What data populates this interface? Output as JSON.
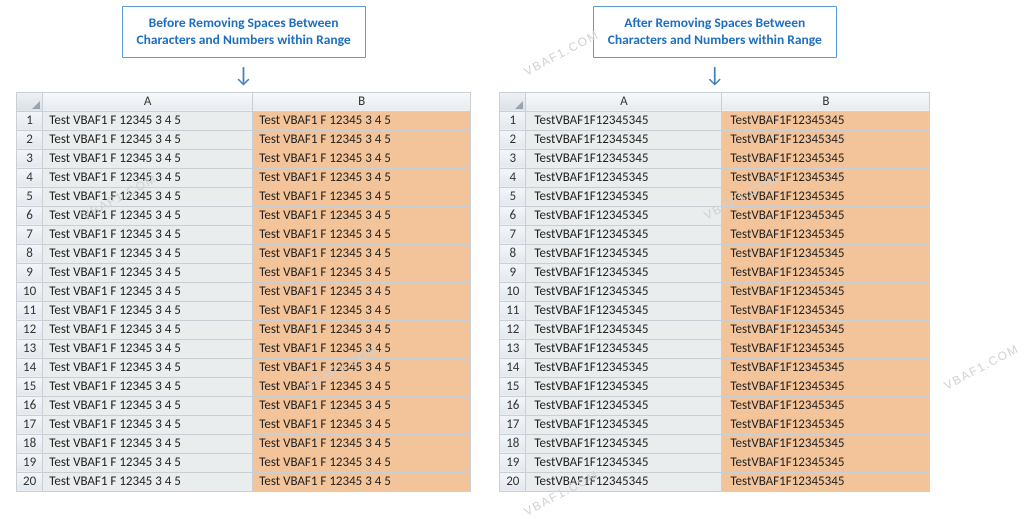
{
  "watermark": "VBAF1.COM",
  "left": {
    "title_line1": "Before Removing Spaces Between",
    "title_line2": "Characters and Numbers within Range",
    "col_a_label": "A",
    "col_b_label": "B",
    "cell_value": "Test    VBAF1    F    12345    3  4  5",
    "row_count": 20
  },
  "right": {
    "title_line1": "After Removing Spaces Between",
    "title_line2": "Characters and Numbers within Range",
    "col_a_label": "A",
    "col_b_label": "B",
    "cell_value": "TestVBAF1F12345345",
    "row_count": 20
  },
  "chart_data": {
    "type": "table",
    "title": "Before vs After Removing Spaces Between Characters and Numbers within Range",
    "tables": [
      {
        "name": "before",
        "columns": [
          "A",
          "B"
        ],
        "rows": 20,
        "uniform_row": [
          "Test    VBAF1    F    12345    3  4  5",
          "Test    VBAF1    F    12345    3  4  5"
        ]
      },
      {
        "name": "after",
        "columns": [
          "A",
          "B"
        ],
        "rows": 20,
        "uniform_row": [
          "TestVBAF1F12345345",
          "TestVBAF1F12345345"
        ]
      }
    ]
  }
}
